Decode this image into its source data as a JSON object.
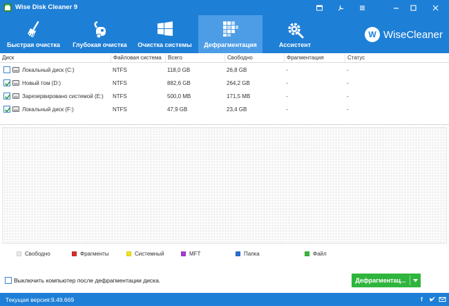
{
  "window": {
    "title": "Wise Disk Cleaner 9"
  },
  "toolbar": {
    "items": [
      {
        "label": "Быстрая очистка",
        "icon": "broom-icon"
      },
      {
        "label": "Глубокая очистка",
        "icon": "vacuum-icon"
      },
      {
        "label": "Очистка системы",
        "icon": "windows-icon"
      },
      {
        "label": "Дефрагментация",
        "icon": "defrag-icon",
        "active": true
      },
      {
        "label": "Ассистент",
        "icon": "gear-wrench-icon"
      }
    ],
    "brand": {
      "logo_letter": "W",
      "name": "WiseCleaner"
    }
  },
  "table": {
    "headers": [
      "Диск",
      "Файловая система",
      "Всего",
      "Свободно",
      "Фрагментация",
      "Статус"
    ],
    "rows": [
      {
        "checked": false,
        "disk": "Локальный диск (C:)",
        "fs": "NTFS",
        "total": "118,0 GB",
        "free": "26,8 GB",
        "frag": "-",
        "status": "-"
      },
      {
        "checked": true,
        "disk": "Новый том (D:)",
        "fs": "NTFS",
        "total": "882,6 GB",
        "free": "264,2 GB",
        "frag": "-",
        "status": "-"
      },
      {
        "checked": true,
        "disk": "Зарезервировано системой (E:)",
        "fs": "NTFS",
        "total": "500,0 MB",
        "free": "171,5 MB",
        "frag": "-",
        "status": "-"
      },
      {
        "checked": true,
        "disk": "Локальный диск (F:)",
        "fs": "NTFS",
        "total": "47,9 GB",
        "free": "23,4 GB",
        "frag": "-",
        "status": "-"
      }
    ]
  },
  "legend": [
    {
      "label": "Свободно",
      "color": "#e8e8e8"
    },
    {
      "label": "Фрагменты",
      "color": "#d62d2d"
    },
    {
      "label": "Системный",
      "color": "#f2e21a"
    },
    {
      "label": "MFT",
      "color": "#a33dd1"
    },
    {
      "label": "Папка",
      "color": "#2a6fd0"
    },
    {
      "label": "Файл",
      "color": "#3db53d"
    }
  ],
  "options": {
    "shutdown_label": "Выключить компьютер после дефрагментации диска."
  },
  "actions": {
    "defrag_label": "Дефрагментац..."
  },
  "status": {
    "version": "Текущая версия:9.49.669"
  },
  "colors": {
    "accent": "#1e7fd6",
    "active_tab": "#4c9de6",
    "defrag_button": "#2fb53d"
  }
}
